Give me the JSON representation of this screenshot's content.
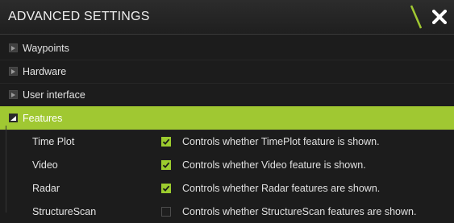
{
  "window": {
    "title": "ADVANCED SETTINGS",
    "accent_color": "#a0c832",
    "close_icon": "close-x-icon"
  },
  "categories": [
    {
      "label": "Waypoints",
      "expanded": false
    },
    {
      "label": "Hardware",
      "expanded": false
    },
    {
      "label": "User interface",
      "expanded": false
    },
    {
      "label": "Features",
      "expanded": true,
      "selected": true
    }
  ],
  "features": [
    {
      "name": "Time Plot",
      "checked": true,
      "description": "Controls whether TimePlot feature is shown."
    },
    {
      "name": "Video",
      "checked": true,
      "description": "Controls whether Video feature is shown."
    },
    {
      "name": "Radar",
      "checked": true,
      "description": "Controls whether Radar features are shown."
    },
    {
      "name": "StructureScan",
      "checked": false,
      "description": "Controls whether StructureScan features are shown."
    }
  ]
}
